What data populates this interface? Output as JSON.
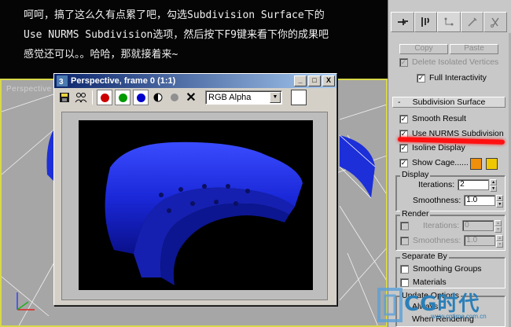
{
  "caption": {
    "lines": [
      "呵呵，搞了这么久有点累了吧，勾选Subdivision Surface下的",
      "Use NURMS Subdivision选项，然后按下F9键来看下你的成果吧",
      "感觉还可以。。哈哈，那就接着来~"
    ]
  },
  "viewport": {
    "label": "Perspective"
  },
  "render_window": {
    "title": "Perspective, frame 0 (1:1)",
    "minimize_label": "_",
    "maximize_label": "□",
    "close_label": "X",
    "channel_value": "RGB Alpha",
    "icons": [
      "save-icon",
      "clone-icon",
      "red-channel-icon",
      "green-channel-icon",
      "blue-channel-icon",
      "alpha-channel-icon",
      "mono-icon",
      "clear-icon"
    ],
    "colors": {
      "red": "#cc0000",
      "green": "#009900",
      "blue": "#0000cc",
      "render_bg": "#000000"
    }
  },
  "panel": {
    "copy_label": "Copy",
    "paste_label": "Paste",
    "delete_isolated": "Delete Isolated Vertices",
    "full_interactivity": "Full Interactivity",
    "rollout_title": "Subdivision Surface",
    "rollout_toggle": "-",
    "smooth_result": "Smooth Result",
    "use_nurms": "Use NURMS Subdivision",
    "isoline_display": "Isoline Display",
    "show_cage": "Show Cage......",
    "cage_colors": [
      "#f0900a",
      "#f0c800"
    ],
    "display_group": {
      "title": "Display",
      "iterations_label": "Iterations:",
      "iterations_value": "2",
      "smoothness_label": "Smoothness:",
      "smoothness_value": "1.0"
    },
    "render_group": {
      "title": "Render",
      "iterations_label": "Iterations:",
      "iterations_value": "0",
      "smoothness_label": "Smoothness:",
      "smoothness_value": "1.0"
    },
    "separate_group": {
      "title": "Separate By",
      "smoothing_groups": "Smoothing Groups",
      "materials": "Materials"
    },
    "update_group": {
      "title": "Update Options",
      "always": "Always",
      "when_rendering": "When Rendering"
    }
  },
  "watermark": {
    "brand": "CG时代",
    "url": "www.cgtime.com.cn"
  }
}
